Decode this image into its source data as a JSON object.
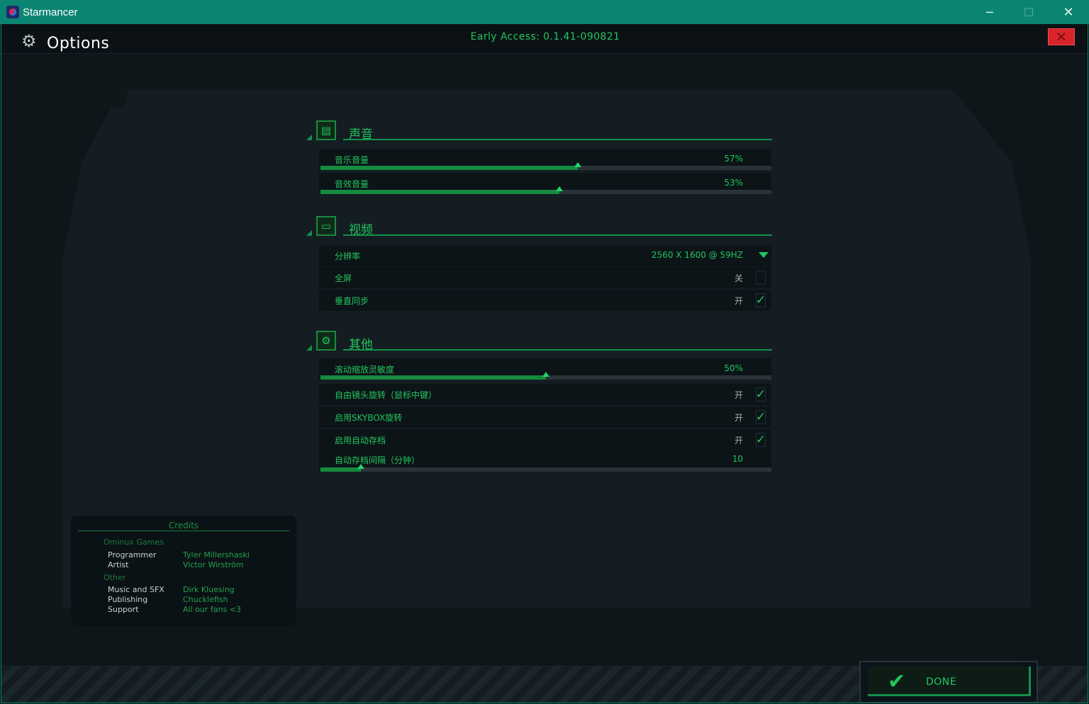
{
  "window": {
    "title": "Starmancer",
    "minimize": "─",
    "maximize": "☐",
    "close": "✕"
  },
  "header": {
    "title": "Options",
    "version": "Early Access: 0.1.41-090821",
    "close_icon": "✕"
  },
  "sections": {
    "sound": {
      "label": "声音",
      "icon": "radio-icon",
      "music": {
        "label": "音乐音量",
        "value": "57%",
        "level": 0.57
      },
      "sfx": {
        "label": "音效音量",
        "value": "53%",
        "level": 0.53
      }
    },
    "video": {
      "label": "视频",
      "icon": "monitor-icon",
      "resolution": {
        "label": "分辨率",
        "value": "2560 X 1600 @ 59HZ"
      },
      "fullscreen": {
        "label": "全屏",
        "state": "关",
        "checked": false
      },
      "vsync": {
        "label": "垂直同步",
        "state": "开",
        "checked": true
      }
    },
    "other": {
      "label": "其他",
      "icon": "gear-icon",
      "scroll_zoom": {
        "label": "滚动缩放灵敏度",
        "value": "50%",
        "level": 0.5
      },
      "free_camera": {
        "label": "自由镜头旋转（鼠标中键）",
        "state": "开",
        "checked": true
      },
      "skybox": {
        "label": "启用SKYBOX旋转",
        "state": "开",
        "checked": true
      },
      "autosave": {
        "label": "启用自动存档",
        "state": "开",
        "checked": true
      },
      "autosave_interval": {
        "label": "自动存档间隔（分钟）",
        "value": "10",
        "level": 0.09
      }
    }
  },
  "credits": {
    "title": "Credits",
    "groups": [
      {
        "name": "Ominux Games",
        "entries": [
          {
            "role": "Programmer",
            "name": "Tyler Millershaski"
          },
          {
            "role": "Artist",
            "name": "Victor Wirström"
          }
        ]
      },
      {
        "name": "Other",
        "entries": [
          {
            "role": "Music and SFX",
            "name": "Dirk Kluesing"
          },
          {
            "role": "Publishing",
            "name": "Chucklefish"
          },
          {
            "role": "Support",
            "name": "All our fans <3"
          }
        ]
      }
    ]
  },
  "done_button": {
    "label": "DONE"
  },
  "colors": {
    "accent": "#22c55e",
    "titlebar": "#0b8572",
    "close_red": "#d9242c"
  }
}
